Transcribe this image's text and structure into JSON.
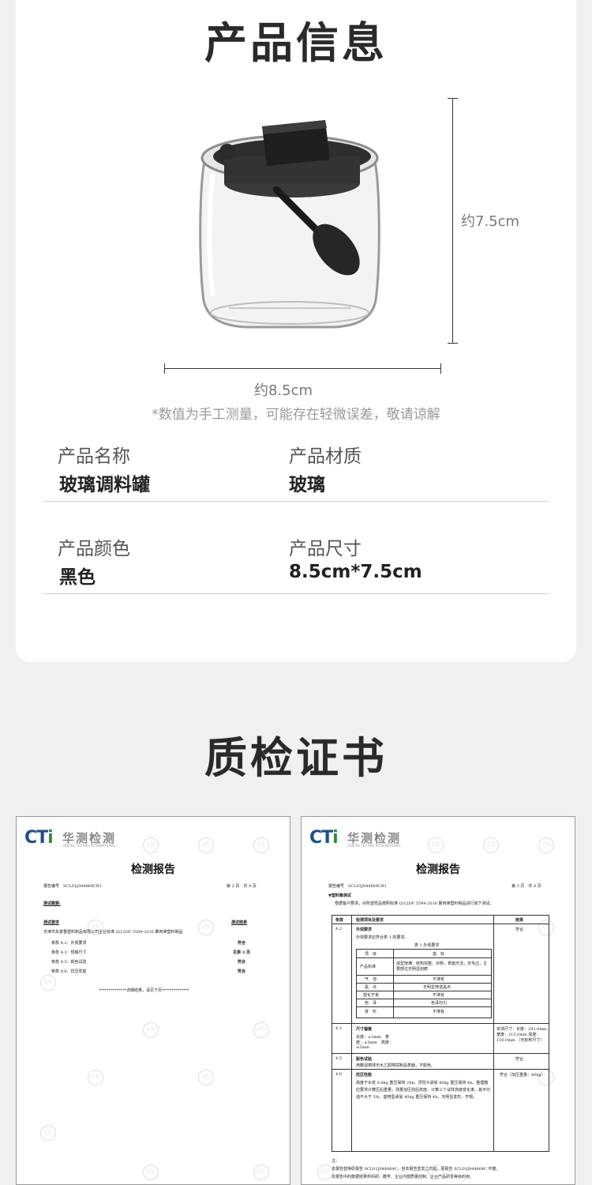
{
  "section1": {
    "title": "产品信息"
  },
  "dimensions": {
    "height": "约7.5cm",
    "width": "约8.5cm"
  },
  "note": "*数值为手工测量，可能存在轻微误差，敬请谅解",
  "specs": [
    {
      "label": "产品名称",
      "value": "玻璃调料罐"
    },
    {
      "label": "产品材质",
      "value": "玻璃"
    },
    {
      "label": "产品颜色",
      "value": "黑色"
    },
    {
      "label": "产品尺寸",
      "value": "8.5cm*7.5cm"
    }
  ],
  "section2": {
    "title": "质检证书"
  },
  "report1": {
    "logo_cn": "华测检测",
    "logo_en": "CENTRE TESTING INTERNATIONAL",
    "title": "检测报告",
    "report_no": "报告编号　SCL01J044864CR1",
    "page": "第 2 页　共 4 页",
    "summary_head": "测试概要:",
    "req_head": "测试要求",
    "result_head": "测试结果",
    "req_text": "天津市永富香塑料制品有限公司企业标准 Q/12DF 5599-2016 聚丙烯塑料制品",
    "items": [
      {
        "name": "条款 4.2：外观要求",
        "result": "符合"
      },
      {
        "name": "条款 4.3：规格尺寸",
        "result": "见第 3 页"
      },
      {
        "name": "条款 4.5：颜色试验",
        "result": "符合"
      },
      {
        "name": "条款 4.6：抗压性能",
        "result": "符合"
      }
    ],
    "footer": "**************详细结果，请见下页**************"
  },
  "report2": {
    "logo_cn": "华测检测",
    "title": "检测报告",
    "report_no": "报告编号　SCL01J044864CR1",
    "page": "第 3 页　共 4 页",
    "section_head": "▼塑料聚测试",
    "section_desc": "根据客户要求，对所送样品按照标准 Q/12DF 5599-2016 聚丙烯塑料制品进行如下测试。",
    "col_item": "条款",
    "col_req": "检测项目及要求",
    "col_result": "结果",
    "rows": [
      {
        "no": "4.2",
        "req": "外观要求",
        "sub": "外观要求应符合表 1 的要求。",
        "result": "符合"
      },
      {
        "no": "4.3",
        "req": "尺寸偏差",
        "sub": "长度：±3mm　宽度：±3mm　高度：±5mm",
        "result": "实测尺寸：长度：243.0mm 宽度：215.0mm 高度：150.0mm （无标称尺寸）"
      },
      {
        "no": "4.5",
        "req": "脱色试验",
        "sub": "用醮湿棉球无水乙醇擦拭制品表面，不脱色。",
        "result": "符合"
      },
      {
        "no": "4.6",
        "req": "抗压性能",
        "sub": "高度于水变 8.8kg 重压保持 24h，顶觉子承受 40kg 重压保持 4h。整理箱应要求计算压后重量，测量加压前后高度，计算三个试样高度变化率。其平均值不大于 5%。座椅型承受 40kg 重压保持 4h，无明显变形、开裂。",
        "result": "符合（加压重量：40kg）"
      }
    ],
    "table1_title": "表 1 外观要求",
    "table1": [
      {
        "k": "项　目",
        "v": "指　标"
      },
      {
        "k": "产品标准",
        "v": "成型饱满、结构完整、对称，表面光洁，无毛边，主要部位无明显划痕"
      },
      {
        "k": "气　泡",
        "v": "不准有"
      },
      {
        "k": "黑　点",
        "v": "无明显穿透黑点"
      },
      {
        "k": "塑化不良",
        "v": "不准有"
      },
      {
        "k": "色　泽",
        "v": "色泽均匀"
      },
      {
        "k": "变　形",
        "v": "不准有"
      }
    ],
    "notes_head": "注：",
    "note1": "本报告替换原报告 SCL01J044864C，自本报告签发之日起，原报告 SCL01J044864C 作废。",
    "note2": "本报告中的数据结果供科研、教学、企业内部质量控制、企业产品研发等目的用。"
  }
}
